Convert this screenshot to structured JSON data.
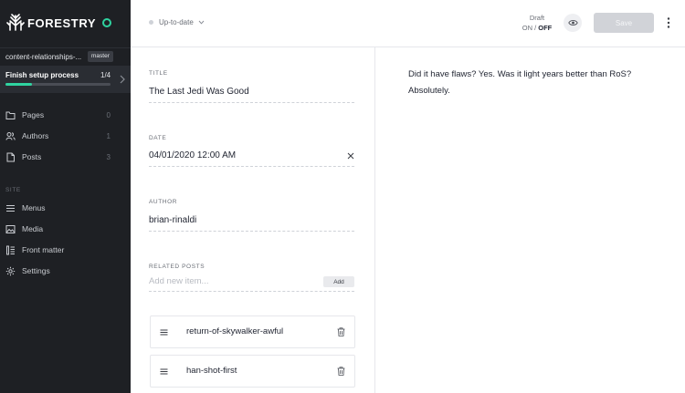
{
  "app": {
    "brand": "FORESTRY",
    "site_name": "content-relationships-...",
    "branch": "master"
  },
  "setup": {
    "title": "Finish setup process",
    "count": "1/4",
    "progress": 0.25
  },
  "sidebar": {
    "content_items": [
      {
        "label": "Pages",
        "count": "0",
        "icon": "pages-icon"
      },
      {
        "label": "Authors",
        "count": "1",
        "icon": "authors-icon"
      },
      {
        "label": "Posts",
        "count": "3",
        "icon": "posts-icon"
      }
    ],
    "section_label": "SITE",
    "site_items": [
      {
        "label": "Menus",
        "icon": "menus-icon"
      },
      {
        "label": "Media",
        "icon": "media-icon"
      },
      {
        "label": "Front matter",
        "icon": "front-matter-icon"
      },
      {
        "label": "Settings",
        "icon": "settings-icon"
      }
    ]
  },
  "header": {
    "status": "Up-to-date",
    "draft_label": "Draft",
    "draft_on": "ON",
    "draft_separator": "/",
    "draft_off": "OFF",
    "save_label": "Save"
  },
  "form": {
    "title_label": "TITLE",
    "title_value": "The Last Jedi Was Good",
    "date_label": "DATE",
    "date_value": "04/01/2020 12:00 AM",
    "author_label": "AUTHOR",
    "author_value": "brian-rinaldi",
    "related_label": "RELATED POSTS",
    "related_placeholder": "Add new item...",
    "add_label": "Add",
    "related_items": [
      "return-of-skywalker-awful",
      "han-shot-first"
    ]
  },
  "body": {
    "text": "Did it have flaws? Yes. Was it light years better than RoS? Absolutely."
  },
  "colors": {
    "sidebar_bg": "#1e2024",
    "accent": "#2fd3a0",
    "save_disabled": "#d1d3d8"
  }
}
